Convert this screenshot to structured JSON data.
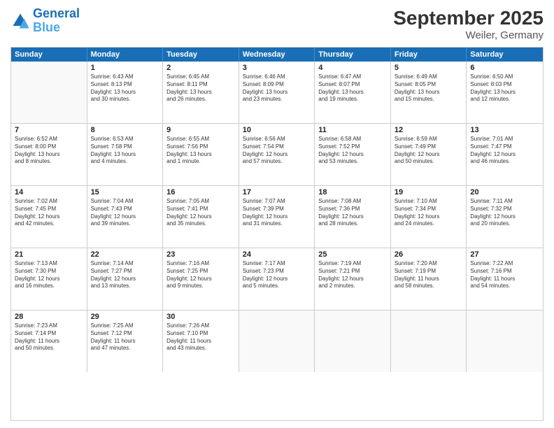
{
  "logo": {
    "text1": "General",
    "text2": "Blue"
  },
  "title": "September 2025",
  "subtitle": "Weiler, Germany",
  "days": [
    "Sunday",
    "Monday",
    "Tuesday",
    "Wednesday",
    "Thursday",
    "Friday",
    "Saturday"
  ],
  "weeks": [
    [
      {
        "day": "",
        "info": ""
      },
      {
        "day": "1",
        "info": "Sunrise: 6:43 AM\nSunset: 8:13 PM\nDaylight: 13 hours\nand 30 minutes."
      },
      {
        "day": "2",
        "info": "Sunrise: 6:45 AM\nSunset: 8:11 PM\nDaylight: 13 hours\nand 26 minutes."
      },
      {
        "day": "3",
        "info": "Sunrise: 6:46 AM\nSunset: 8:09 PM\nDaylight: 13 hours\nand 23 minutes."
      },
      {
        "day": "4",
        "info": "Sunrise: 6:47 AM\nSunset: 8:07 PM\nDaylight: 13 hours\nand 19 minutes."
      },
      {
        "day": "5",
        "info": "Sunrise: 6:49 AM\nSunset: 8:05 PM\nDaylight: 13 hours\nand 15 minutes."
      },
      {
        "day": "6",
        "info": "Sunrise: 6:50 AM\nSunset: 8:03 PM\nDaylight: 13 hours\nand 12 minutes."
      }
    ],
    [
      {
        "day": "7",
        "info": "Sunrise: 6:52 AM\nSunset: 8:00 PM\nDaylight: 13 hours\nand 8 minutes."
      },
      {
        "day": "8",
        "info": "Sunrise: 6:53 AM\nSunset: 7:58 PM\nDaylight: 13 hours\nand 4 minutes."
      },
      {
        "day": "9",
        "info": "Sunrise: 6:55 AM\nSunset: 7:56 PM\nDaylight: 13 hours\nand 1 minute."
      },
      {
        "day": "10",
        "info": "Sunrise: 6:56 AM\nSunset: 7:54 PM\nDaylight: 12 hours\nand 57 minutes."
      },
      {
        "day": "11",
        "info": "Sunrise: 6:58 AM\nSunset: 7:52 PM\nDaylight: 12 hours\nand 53 minutes."
      },
      {
        "day": "12",
        "info": "Sunrise: 6:59 AM\nSunset: 7:49 PM\nDaylight: 12 hours\nand 50 minutes."
      },
      {
        "day": "13",
        "info": "Sunrise: 7:01 AM\nSunset: 7:47 PM\nDaylight: 12 hours\nand 46 minutes."
      }
    ],
    [
      {
        "day": "14",
        "info": "Sunrise: 7:02 AM\nSunset: 7:45 PM\nDaylight: 12 hours\nand 42 minutes."
      },
      {
        "day": "15",
        "info": "Sunrise: 7:04 AM\nSunset: 7:43 PM\nDaylight: 12 hours\nand 39 minutes."
      },
      {
        "day": "16",
        "info": "Sunrise: 7:05 AM\nSunset: 7:41 PM\nDaylight: 12 hours\nand 35 minutes."
      },
      {
        "day": "17",
        "info": "Sunrise: 7:07 AM\nSunset: 7:39 PM\nDaylight: 12 hours\nand 31 minutes."
      },
      {
        "day": "18",
        "info": "Sunrise: 7:08 AM\nSunset: 7:36 PM\nDaylight: 12 hours\nand 28 minutes."
      },
      {
        "day": "19",
        "info": "Sunrise: 7:10 AM\nSunset: 7:34 PM\nDaylight: 12 hours\nand 24 minutes."
      },
      {
        "day": "20",
        "info": "Sunrise: 7:11 AM\nSunset: 7:32 PM\nDaylight: 12 hours\nand 20 minutes."
      }
    ],
    [
      {
        "day": "21",
        "info": "Sunrise: 7:13 AM\nSunset: 7:30 PM\nDaylight: 12 hours\nand 16 minutes."
      },
      {
        "day": "22",
        "info": "Sunrise: 7:14 AM\nSunset: 7:27 PM\nDaylight: 12 hours\nand 13 minutes."
      },
      {
        "day": "23",
        "info": "Sunrise: 7:16 AM\nSunset: 7:25 PM\nDaylight: 12 hours\nand 9 minutes."
      },
      {
        "day": "24",
        "info": "Sunrise: 7:17 AM\nSunset: 7:23 PM\nDaylight: 12 hours\nand 5 minutes."
      },
      {
        "day": "25",
        "info": "Sunrise: 7:19 AM\nSunset: 7:21 PM\nDaylight: 12 hours\nand 2 minutes."
      },
      {
        "day": "26",
        "info": "Sunrise: 7:20 AM\nSunset: 7:19 PM\nDaylight: 11 hours\nand 58 minutes."
      },
      {
        "day": "27",
        "info": "Sunrise: 7:22 AM\nSunset: 7:16 PM\nDaylight: 11 hours\nand 54 minutes."
      }
    ],
    [
      {
        "day": "28",
        "info": "Sunrise: 7:23 AM\nSunset: 7:14 PM\nDaylight: 11 hours\nand 50 minutes."
      },
      {
        "day": "29",
        "info": "Sunrise: 7:25 AM\nSunset: 7:12 PM\nDaylight: 11 hours\nand 47 minutes."
      },
      {
        "day": "30",
        "info": "Sunrise: 7:26 AM\nSunset: 7:10 PM\nDaylight: 11 hours\nand 43 minutes."
      },
      {
        "day": "",
        "info": ""
      },
      {
        "day": "",
        "info": ""
      },
      {
        "day": "",
        "info": ""
      },
      {
        "day": "",
        "info": ""
      }
    ]
  ]
}
